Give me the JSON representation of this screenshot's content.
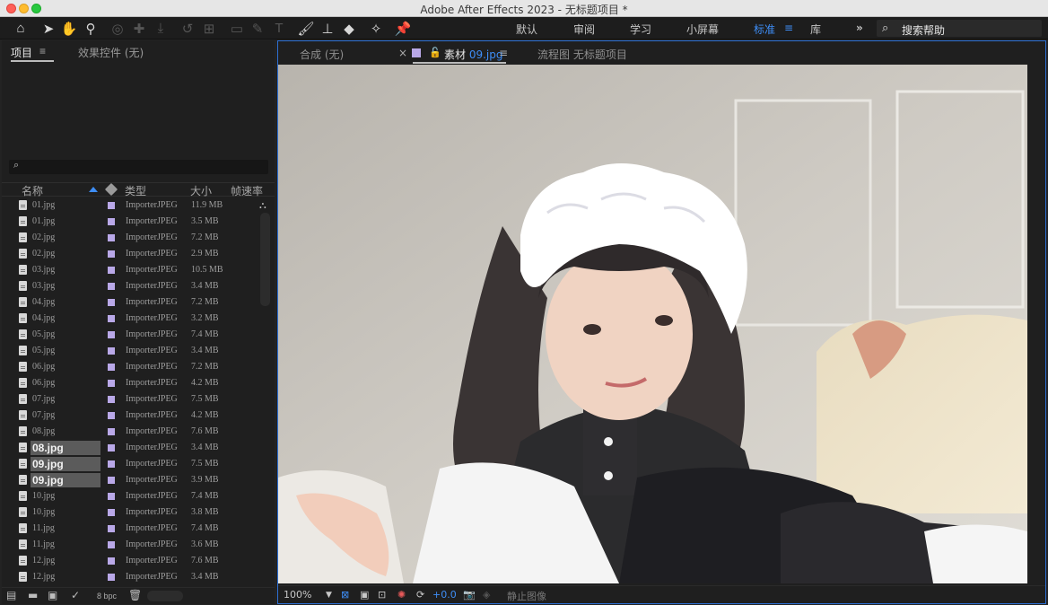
{
  "window": {
    "title": "Adobe After Effects 2023 - 无标题项目 *"
  },
  "toolbar": {
    "workspaces": [
      "默认",
      "审阅",
      "学习",
      "小屏幕",
      "标准",
      "库"
    ],
    "active_workspace": "标准",
    "overflow": "»",
    "search_placeholder": "搜索帮助"
  },
  "project_panel": {
    "tab_project": "项目",
    "tab_effects": "效果控件 (无)",
    "search_glyph": "⌕",
    "columns": {
      "name": "名称",
      "type": "类型",
      "size": "大小",
      "fps": "帧速率"
    },
    "files": [
      {
        "name": "01.jpg",
        "type": "ImporterJPEG",
        "size": "11.9 MB"
      },
      {
        "name": "01.jpg",
        "type": "ImporterJPEG",
        "size": "3.5 MB"
      },
      {
        "name": "02.jpg",
        "type": "ImporterJPEG",
        "size": "7.2 MB"
      },
      {
        "name": "02.jpg",
        "type": "ImporterJPEG",
        "size": "2.9 MB"
      },
      {
        "name": "03.jpg",
        "type": "ImporterJPEG",
        "size": "10.5 MB"
      },
      {
        "name": "03.jpg",
        "type": "ImporterJPEG",
        "size": "3.4 MB"
      },
      {
        "name": "04.jpg",
        "type": "ImporterJPEG",
        "size": "7.2 MB"
      },
      {
        "name": "04.jpg",
        "type": "ImporterJPEG",
        "size": "3.2 MB"
      },
      {
        "name": "05.jpg",
        "type": "ImporterJPEG",
        "size": "7.4 MB"
      },
      {
        "name": "05.jpg",
        "type": "ImporterJPEG",
        "size": "3.4 MB"
      },
      {
        "name": "06.jpg",
        "type": "ImporterJPEG",
        "size": "7.2 MB"
      },
      {
        "name": "06.jpg",
        "type": "ImporterJPEG",
        "size": "4.2 MB"
      },
      {
        "name": "07.jpg",
        "type": "ImporterJPEG",
        "size": "7.5 MB"
      },
      {
        "name": "07.jpg",
        "type": "ImporterJPEG",
        "size": "4.2 MB"
      },
      {
        "name": "08.jpg",
        "type": "ImporterJPEG",
        "size": "7.6 MB"
      },
      {
        "name": "08.jpg",
        "type": "ImporterJPEG",
        "size": "3.4 MB",
        "selected": true
      },
      {
        "name": "09.jpg",
        "type": "ImporterJPEG",
        "size": "7.5 MB",
        "selected": true
      },
      {
        "name": "09.jpg",
        "type": "ImporterJPEG",
        "size": "3.9 MB",
        "selected": true
      },
      {
        "name": "10.jpg",
        "type": "ImporterJPEG",
        "size": "7.4 MB"
      },
      {
        "name": "10.jpg",
        "type": "ImporterJPEG",
        "size": "3.8 MB"
      },
      {
        "name": "11.jpg",
        "type": "ImporterJPEG",
        "size": "7.4 MB"
      },
      {
        "name": "11.jpg",
        "type": "ImporterJPEG",
        "size": "3.6 MB"
      },
      {
        "name": "12.jpg",
        "type": "ImporterJPEG",
        "size": "7.6 MB"
      },
      {
        "name": "12.jpg",
        "type": "ImporterJPEG",
        "size": "3.4 MB"
      }
    ],
    "bit_depth": "8 bpc"
  },
  "viewer": {
    "tab_comp": "合成 (无)",
    "tab_footage_prefix": "素材",
    "tab_footage_file": "09.jpg",
    "tab_flowchart": "流程图 无标题项目",
    "zoom": "100%",
    "exposure": "+0.0",
    "freeze_label": "静止图像"
  },
  "colors": {
    "accent": "#3e8ef7",
    "label_lavender": "#b9a8e8",
    "panel_bg": "#1f1f1f"
  }
}
